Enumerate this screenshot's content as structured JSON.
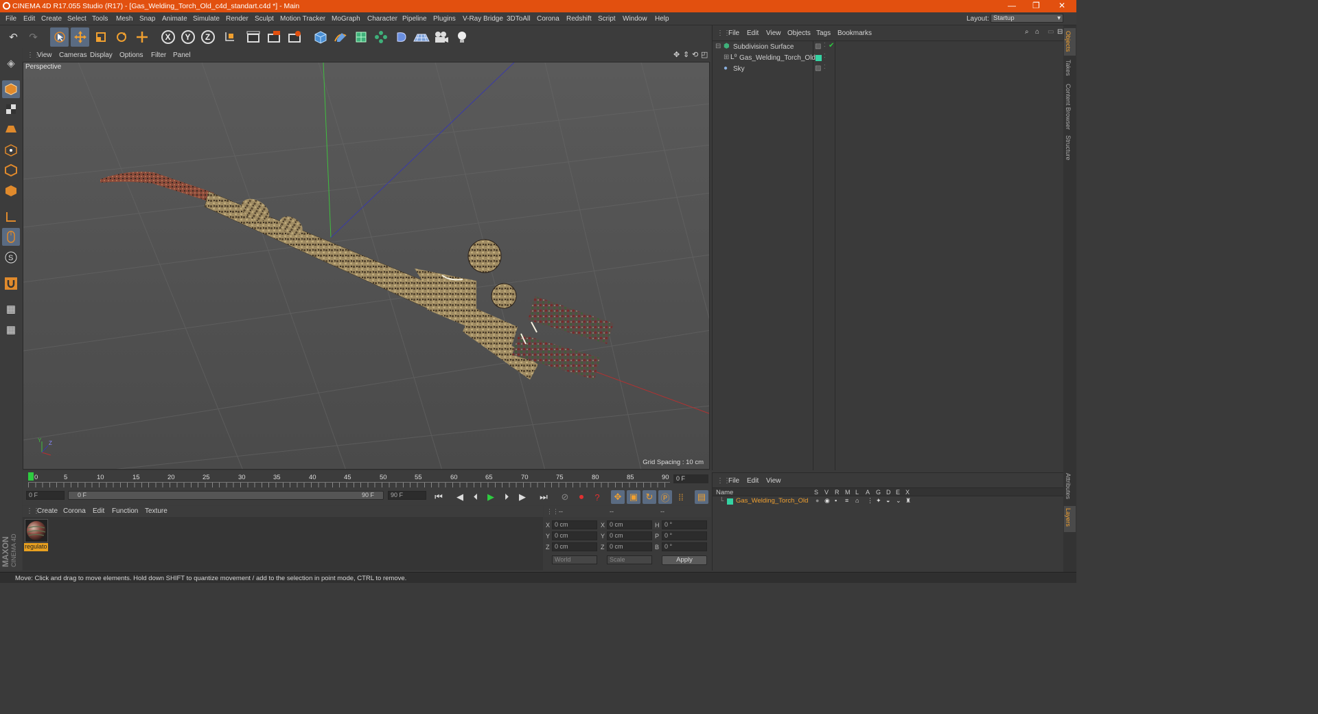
{
  "titlebar": {
    "title": "CINEMA 4D R17.055 Studio (R17) - [Gas_Welding_Torch_Old_c4d_standart.c4d *] - Main",
    "minimize": "—",
    "maximize": "❐",
    "close": "✕"
  },
  "menubar": {
    "items": [
      "File",
      "Edit",
      "Create",
      "Select",
      "Tools",
      "Mesh",
      "Snap",
      "Animate",
      "Simulate",
      "Render",
      "Sculpt",
      "Motion Tracker",
      "MoGraph",
      "Character",
      "Pipeline",
      "Plugins",
      "V-Ray Bridge",
      "3DToAll",
      "Corona",
      "Redshift",
      "Script",
      "Window",
      "Help"
    ],
    "layout_label": "Layout:",
    "layout_value": "Startup"
  },
  "toolbar": {
    "icons": [
      "undo-icon",
      "redo-icon",
      "live-selection-icon",
      "move-icon",
      "scale-icon",
      "rotate-icon",
      "recent-tool-icon",
      "x-axis-icon",
      "y-axis-icon",
      "z-axis-icon",
      "coordinate-system-icon",
      "render-view-icon",
      "render-picture-viewer-icon",
      "edit-render-settings-icon",
      "cube-icon",
      "pen-spline-icon",
      "subdivision-icon",
      "array-icon",
      "deformer-icon",
      "floor-icon",
      "camera-icon",
      "light-icon"
    ],
    "axis_x": "X",
    "axis_y": "Y",
    "axis_z": "Z"
  },
  "viewport": {
    "menu": [
      "View",
      "Cameras",
      "Display",
      "Options",
      "Filter",
      "Panel"
    ],
    "label": "Perspective",
    "grid_spacing": "Grid Spacing : 10 cm",
    "axis_y": "Y",
    "axis_z": "Z"
  },
  "timeline": {
    "ticks": [
      "0",
      "5",
      "10",
      "15",
      "20",
      "25",
      "30",
      "35",
      "40",
      "45",
      "50",
      "55",
      "60",
      "65",
      "70",
      "75",
      "80",
      "85",
      "90"
    ],
    "current_frame": "0 F"
  },
  "playback": {
    "start": "0 F",
    "range_start": "0 F",
    "range_end": "90 F",
    "end": "90 F"
  },
  "material_manager": {
    "menu": [
      "Create",
      "Corona",
      "Edit",
      "Function",
      "Texture"
    ],
    "material_name": "regulato"
  },
  "coordinates": {
    "headers": [
      "--",
      "--",
      "--"
    ],
    "rows": [
      {
        "a": "X",
        "av": "0 cm",
        "b": "X",
        "bv": "0 cm",
        "c": "H",
        "cv": "0 °"
      },
      {
        "a": "Y",
        "av": "0 cm",
        "b": "Y",
        "bv": "0 cm",
        "c": "P",
        "cv": "0 °"
      },
      {
        "a": "Z",
        "av": "0 cm",
        "b": "Z",
        "bv": "0 cm",
        "c": "B",
        "cv": "0 °"
      }
    ],
    "mode1": "World",
    "mode2": "Scale",
    "apply": "Apply"
  },
  "object_manager": {
    "menu": [
      "File",
      "Edit",
      "View",
      "Objects",
      "Tags",
      "Bookmarks"
    ],
    "objects": [
      "Subdivision Surface",
      "Gas_Welding_Torch_Old",
      "Sky"
    ]
  },
  "layer_manager": {
    "menu": [
      "File",
      "Edit",
      "View"
    ],
    "col_name": "Name",
    "cols": [
      "S",
      "V",
      "R",
      "M",
      "L",
      "A",
      "G",
      "D",
      "E",
      "X"
    ],
    "layer_name": "Gas_Welding_Torch_Old"
  },
  "right_tabs": [
    "Objects",
    "Takes",
    "Content Browser",
    "Structure"
  ],
  "right_tabs_bottom": [
    "Attributes",
    "Layers"
  ],
  "status": "Move: Click and drag to move elements. Hold down SHIFT to quantize movement / add to the selection in point mode, CTRL to remove.",
  "brand": [
    "MAXON",
    "CINEMA 4D"
  ],
  "colors": {
    "titlebar": "#e2500f",
    "accent": "#e08a2c",
    "selection": "#5a6b82",
    "layer_swatch": "#35d3a3"
  }
}
